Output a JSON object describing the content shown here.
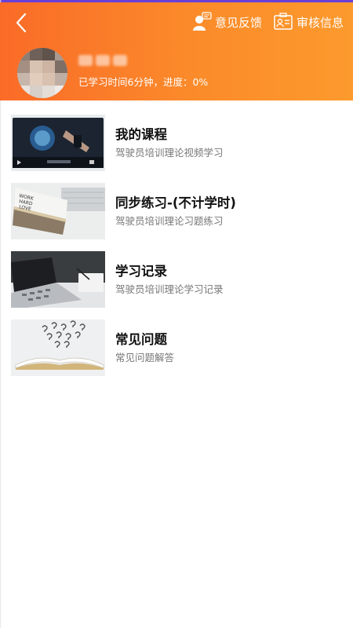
{
  "header": {
    "feedback_label": "意见反馈",
    "audit_label": "审核信息",
    "study_info": "已学习时间6分钟，进度：0%"
  },
  "menu": {
    "items": [
      {
        "title": "我的课程",
        "subtitle": "驾驶员培训理论视频学习"
      },
      {
        "title": "同步练习-(不计学时)",
        "subtitle": "驾驶员培训理论习题练习"
      },
      {
        "title": "学习记录",
        "subtitle": "驾驶员培训理论学习记录"
      },
      {
        "title": "常见问题",
        "subtitle": "常见问题解答"
      }
    ]
  },
  "colors": {
    "header_start": "#fa6b28",
    "header_end": "#fc9a2d",
    "accent_line": "#6a3fd8"
  }
}
